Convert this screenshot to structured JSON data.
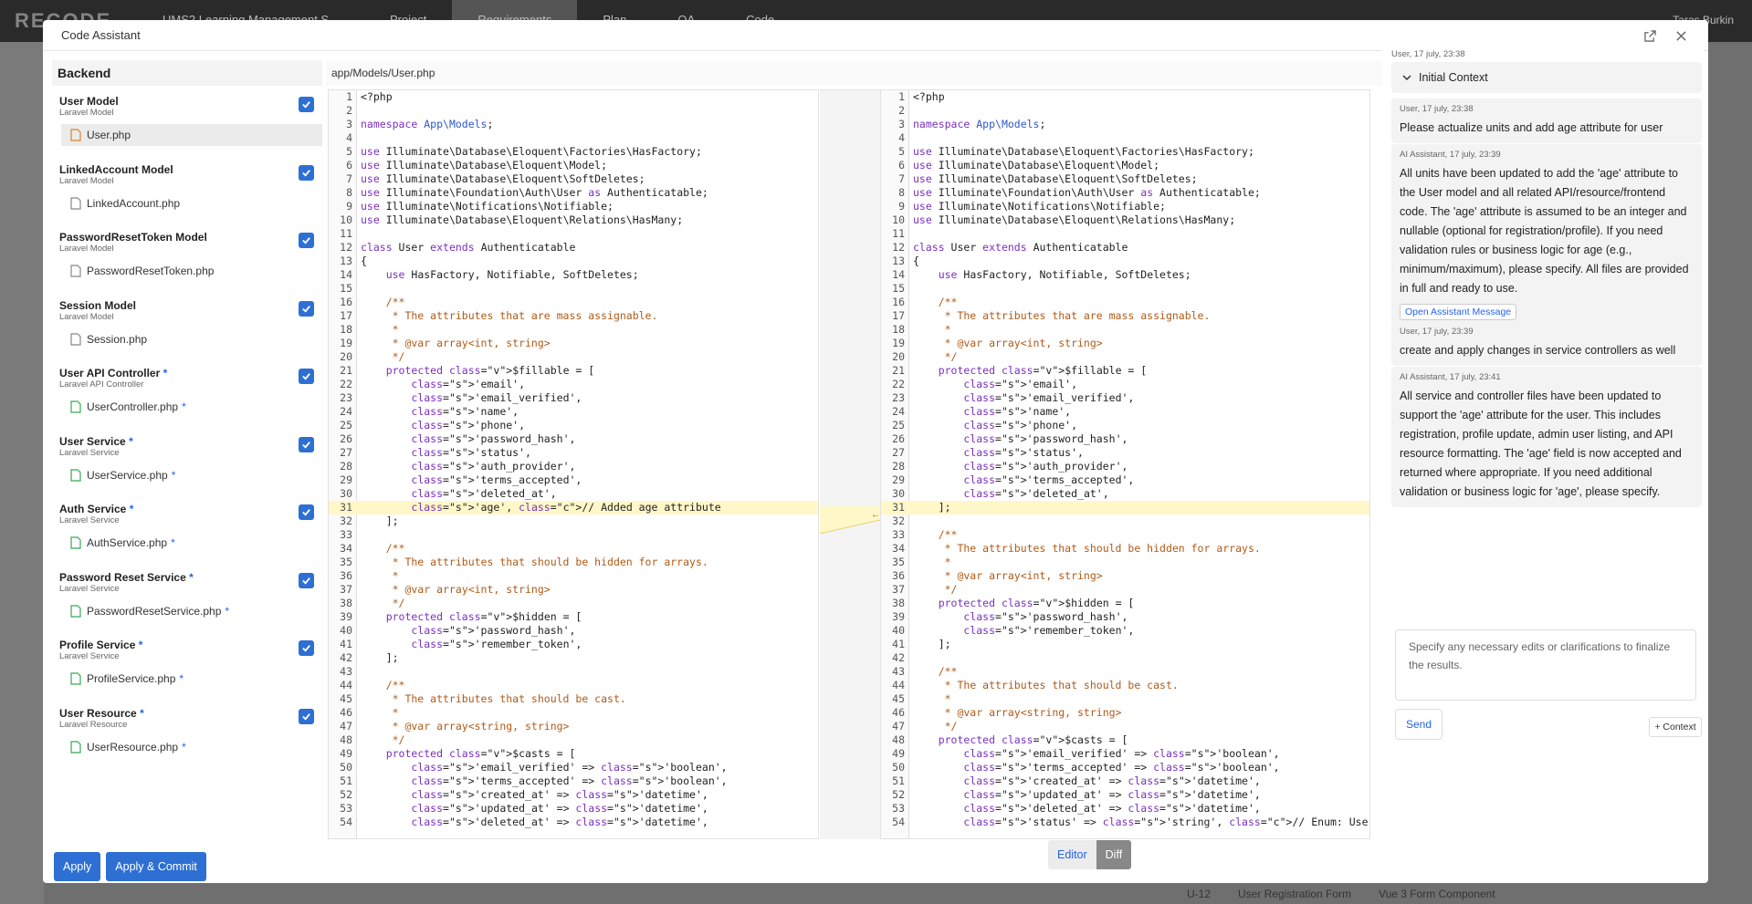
{
  "modal": {
    "title": "Code Assistant"
  },
  "background": {
    "logo": "RECODE",
    "nav": [
      "UMS2 Learning Management S...",
      "Project",
      "Requirements",
      "Plan",
      "QA",
      "Code"
    ],
    "user": "Taras Burkin",
    "bottom": [
      "U-12",
      "User Registration Form",
      "Vue 3 Form Component"
    ]
  },
  "files_panel": {
    "title": "Backend",
    "units": [
      {
        "name": "User Model",
        "modified": false,
        "type": "Laravel Model",
        "file": "User.php",
        "file_modified": false,
        "checked": true
      },
      {
        "name": "LinkedAccount Model",
        "modified": false,
        "type": "Laravel Model",
        "file": "LinkedAccount.php",
        "file_modified": false,
        "checked": true
      },
      {
        "name": "PasswordResetToken Model",
        "modified": false,
        "type": "Laravel Model",
        "file": "PasswordResetToken.php",
        "file_modified": false,
        "checked": true
      },
      {
        "name": "Session Model",
        "modified": false,
        "type": "Laravel Model",
        "file": "Session.php",
        "file_modified": false,
        "checked": true
      },
      {
        "name": "User API Controller",
        "modified": true,
        "type": "Laravel API Controller",
        "file": "UserController.php",
        "file_modified": true,
        "checked": true
      },
      {
        "name": "User Service",
        "modified": true,
        "type": "Laravel Service",
        "file": "UserService.php",
        "file_modified": true,
        "checked": true
      },
      {
        "name": "Auth Service",
        "modified": true,
        "type": "Laravel Service",
        "file": "AuthService.php",
        "file_modified": true,
        "checked": true
      },
      {
        "name": "Password Reset Service",
        "modified": true,
        "type": "Laravel Service",
        "file": "PasswordResetService.php",
        "file_modified": true,
        "checked": true
      },
      {
        "name": "Profile Service",
        "modified": true,
        "type": "Laravel Service",
        "file": "ProfileService.php",
        "file_modified": true,
        "checked": true
      },
      {
        "name": "User Resource",
        "modified": true,
        "type": "Laravel Resource",
        "file": "UserResource.php",
        "file_modified": true,
        "checked": true
      }
    ],
    "star": "*"
  },
  "editor": {
    "path": "app/Models/User.php",
    "left_lines": [
      "<?php",
      "",
      "namespace App\\Models;",
      "",
      "use Illuminate\\Database\\Eloquent\\Factories\\HasFactory;",
      "use Illuminate\\Database\\Eloquent\\Model;",
      "use Illuminate\\Database\\Eloquent\\SoftDeletes;",
      "use Illuminate\\Foundation\\Auth\\User as Authenticatable;",
      "use Illuminate\\Notifications\\Notifiable;",
      "use Illuminate\\Database\\Eloquent\\Relations\\HasMany;",
      "",
      "class User extends Authenticatable",
      "{",
      "    use HasFactory, Notifiable, SoftDeletes;",
      "",
      "    /**",
      "     * The attributes that are mass assignable.",
      "     *",
      "     * @var array<int, string>",
      "     */",
      "    protected $fillable = [",
      "        'email',",
      "        'email_verified',",
      "        'name',",
      "        'phone',",
      "        'password_hash',",
      "        'status',",
      "        'auth_provider',",
      "        'terms_accepted',",
      "        'deleted_at',",
      "        'age', // Added age attribute",
      "    ];",
      "",
      "    /**",
      "     * The attributes that should be hidden for arrays.",
      "     *",
      "     * @var array<int, string>",
      "     */",
      "    protected $hidden = [",
      "        'password_hash',",
      "        'remember_token',",
      "    ];",
      "",
      "    /**",
      "     * The attributes that should be cast.",
      "     *",
      "     * @var array<string, string>",
      "     */",
      "    protected $casts = [",
      "        'email_verified' => 'boolean',",
      "        'terms_accepted' => 'boolean',",
      "        'created_at' => 'datetime',",
      "        'updated_at' => 'datetime',",
      "        'deleted_at' => 'datetime',"
    ],
    "right_lines": [
      "<?php",
      "",
      "namespace App\\Models;",
      "",
      "use Illuminate\\Database\\Eloquent\\Factories\\HasFactory;",
      "use Illuminate\\Database\\Eloquent\\Model;",
      "use Illuminate\\Database\\Eloquent\\SoftDeletes;",
      "use Illuminate\\Foundation\\Auth\\User as Authenticatable;",
      "use Illuminate\\Notifications\\Notifiable;",
      "use Illuminate\\Database\\Eloquent\\Relations\\HasMany;",
      "",
      "class User extends Authenticatable",
      "{",
      "    use HasFactory, Notifiable, SoftDeletes;",
      "",
      "    /**",
      "     * The attributes that are mass assignable.",
      "     *",
      "     * @var array<int, string>",
      "     */",
      "    protected $fillable = [",
      "        'email',",
      "        'email_verified',",
      "        'name',",
      "        'phone',",
      "        'password_hash',",
      "        'status',",
      "        'auth_provider',",
      "        'terms_accepted',",
      "        'deleted_at',",
      "    ];",
      "",
      "    /**",
      "     * The attributes that should be hidden for arrays.",
      "     *",
      "     * @var array<int, string>",
      "     */",
      "    protected $hidden = [",
      "        'password_hash',",
      "        'remember_token',",
      "    ];",
      "",
      "    /**",
      "     * The attributes that should be cast.",
      "     *",
      "     * @var array<string, string>",
      "     */",
      "    protected $casts = [",
      "        'email_verified' => 'boolean',",
      "        'terms_accepted' => 'boolean',",
      "        'created_at' => 'datetime',",
      "        'updated_at' => 'datetime',",
      "        'deleted_at' => 'datetime',",
      "        'status' => 'string', // Enum: User Status"
    ],
    "highlight_line": 31,
    "modes": {
      "editor": "Editor",
      "diff": "Diff",
      "active": "Diff"
    }
  },
  "chat": {
    "context": {
      "meta": "User, 17 july, 23:38",
      "label": "Initial Context"
    },
    "messages": [
      {
        "meta": "User, 17 july, 23:38",
        "text": "Please actualize units and add age attribute for user"
      },
      {
        "meta": "AI Assistant, 17 july, 23:39",
        "text": "All units have been updated to add the 'age' attribute to the User model and all related API/resource/frontend code. The 'age' attribute is assumed to be an integer and nullable (optional for registration/profile). If you need validation rules or business logic for age (e.g., minimum/maximum), please specify. All files are provided in full and ready to use.",
        "button": "Open Assistant Message"
      },
      {
        "meta": "User, 17 july, 23:39",
        "text": "create and apply changes in service controllers as well"
      },
      {
        "meta": "AI Assistant, 17 july, 23:41",
        "text": "All service and controller files have been updated to support the 'age' attribute for the user. This includes registration, profile update, admin user listing, and API resource formatting. The 'age' field is now accepted and returned where appropriate. If you need additional validation or business logic for 'age', please specify."
      }
    ],
    "input_placeholder": "Specify any necessary edits or clarifications to finalize the results.",
    "send_label": "Send",
    "context_button": "+ Context"
  },
  "footer": {
    "apply": "Apply",
    "apply_commit": "Apply & Commit"
  },
  "colors": {
    "accent": "#2d6fd2",
    "highlight": "#fff7c8"
  }
}
